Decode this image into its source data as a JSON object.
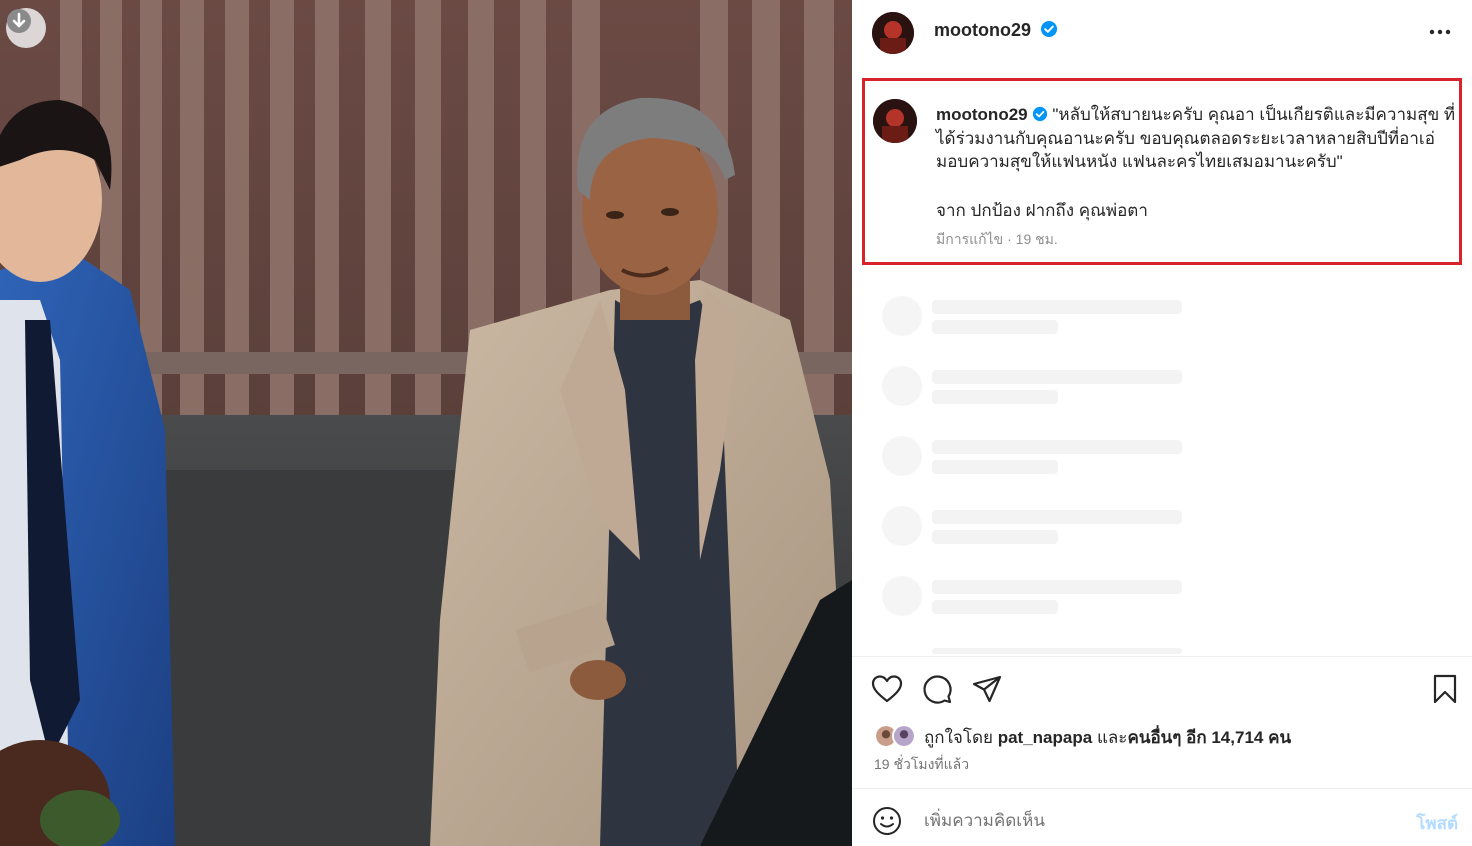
{
  "photo": {
    "alt_icons": {
      "download": "arrow-down-icon"
    }
  },
  "header": {
    "username": "mootono29",
    "verified_icon": "verified-badge-icon",
    "more_icon": "more-horizontal-icon"
  },
  "caption": {
    "username": "mootono29",
    "text": "\"หลับให้สบายนะครับ คุณอา เป็นเกียรติและมีความสุข ที่ได้ร่วมงานกับคุณอานะครับ ขอบคุณตลอดระยะเวลาหลายสิบปีที่อาเอ่มอบความสุขให้แฟนหนัง แฟนละครไทยเสมอมานะครับ\"",
    "signature": "จาก ปกป้อง ฝากถึง คุณพ่อตา",
    "edited_label": "มีการแก้ไข",
    "time": "19 ชม.",
    "highlight_color": "#d9232a"
  },
  "actions": {
    "like_icon": "heart-icon",
    "comment_icon": "comment-icon",
    "share_icon": "share-icon",
    "save_icon": "bookmark-icon"
  },
  "likes": {
    "prefix": "ถูกใจโดย",
    "user": "pat_napapa",
    "connector": "และ",
    "others_label": "คนอื่นๆ อีก 14,714 คน"
  },
  "time_ago": "19 ชั่วโมงที่แล้ว",
  "comment": {
    "emoji_icon": "emoji-icon",
    "placeholder": "เพิ่มความคิดเห็น",
    "post_label": "โพสต์",
    "post_color": "#b3dbff"
  }
}
